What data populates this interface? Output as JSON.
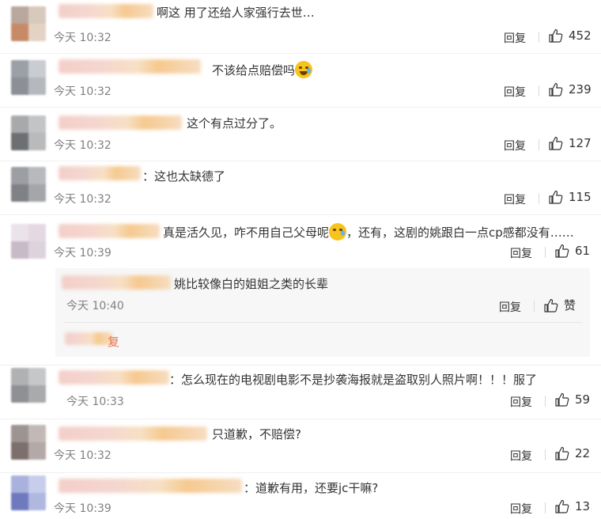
{
  "colors": {
    "link": "#eb7350",
    "time": "#808080",
    "text": "#333333",
    "subbox": "#f7f7f7"
  },
  "comments": [
    {
      "text": "啊这 用了还给人家强行去世…",
      "time": "今天 10:32",
      "reply": "回复",
      "likes": "452"
    },
    {
      "text": "不该给点赔偿吗",
      "emoji": "laugh-cry-emoji",
      "time": "今天 10:32",
      "reply": "回复",
      "likes": "239"
    },
    {
      "text": "这个有点过分了。",
      "time": "今天 10:32",
      "reply": "回复",
      "likes": "127"
    },
    {
      "text": "：这也太缺德了",
      "time": "今天 10:32",
      "reply": "回复",
      "likes": "115"
    },
    {
      "text_a": "真是活久见，咋不用自己父母呢",
      "emoji": "sad-emoji",
      "text_b": "，还有，这剧的姚跟白一点cp感都没有……",
      "time": "今天 10:39",
      "reply": "回复",
      "likes": "61"
    },
    {
      "text": "：怎么现在的电视剧电影不是抄袭海报就是盗取别人照片啊！！！服了",
      "time": "今天 10:33",
      "reply": "回复",
      "likes": "59"
    },
    {
      "text": "只道歉，不赔偿?",
      "time": "今天 10:32",
      "reply": "回复",
      "likes": "22"
    },
    {
      "text": "：道歉有用，还要jc干嘛?",
      "time": "今天 10:39",
      "reply": "回复",
      "likes": "13"
    }
  ],
  "subreply": {
    "text": "姚比较像白的姐姐之类的长辈",
    "time": "今天 10:40",
    "reply": "回复",
    "likes": "赞",
    "more_link": "复"
  }
}
